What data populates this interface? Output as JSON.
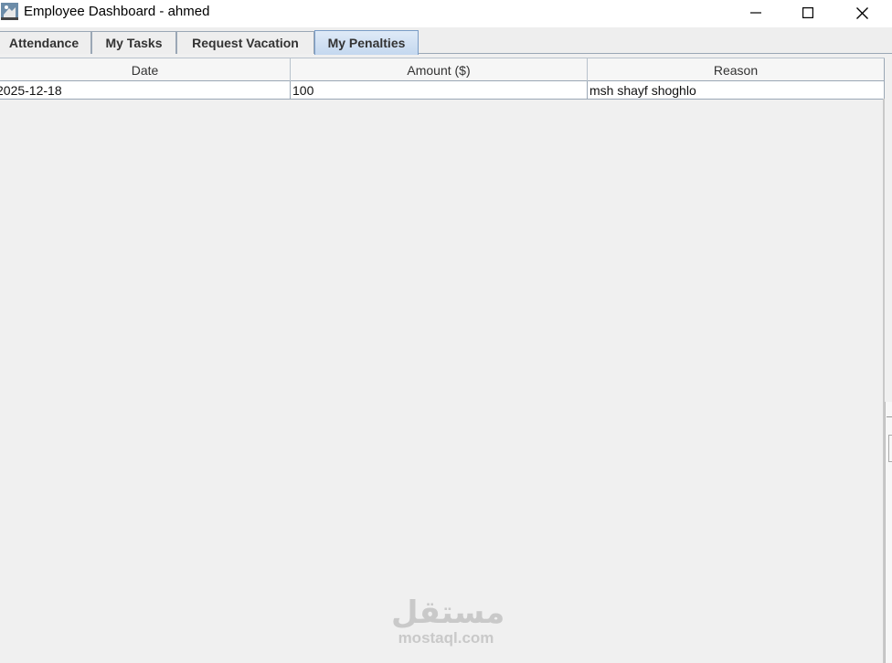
{
  "window": {
    "title": "Employee Dashboard - ahmed",
    "icons": {
      "app": "coffee-cup-icon",
      "minimize": "minimize-icon",
      "maximize": "maximize-icon",
      "close": "close-icon"
    }
  },
  "tabs": [
    {
      "label": "Attendance",
      "selected": false
    },
    {
      "label": "My Tasks",
      "selected": false
    },
    {
      "label": "Request Vacation",
      "selected": false
    },
    {
      "label": "My Penalties",
      "selected": true
    }
  ],
  "penalties_table": {
    "columns": [
      "Date",
      "Amount ($)",
      "Reason"
    ],
    "rows": [
      {
        "date": "2025-12-18",
        "amount": "100",
        "reason": "msh shayf shoghlo"
      }
    ]
  },
  "watermark": {
    "logo": "مستقل",
    "url": "mostaql.com"
  },
  "colors": {
    "selected_tab": "#c4d8ef",
    "background": "#f0f0f0",
    "grid": "#9aa7b5"
  }
}
